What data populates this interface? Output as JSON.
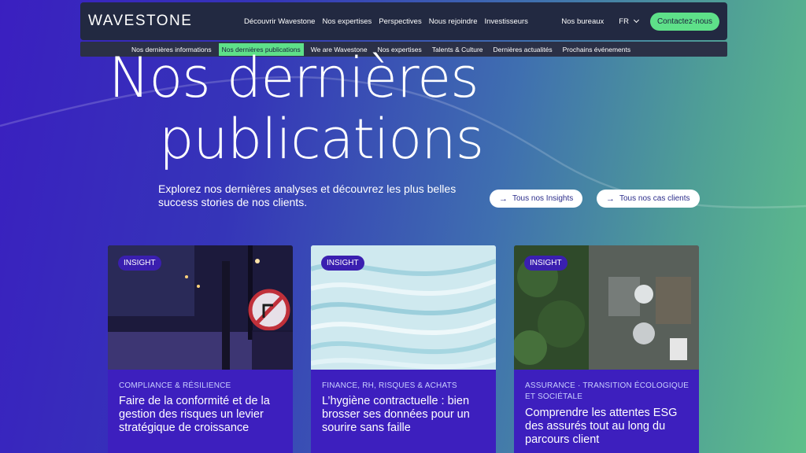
{
  "colors": {
    "accent": "#5ee089",
    "nav_bg": "#222941",
    "card_bg": "#3d1fbe"
  },
  "header": {
    "logo": "WAVESTONE",
    "menu": [
      "Découvrir Wavestone",
      "Nos expertises",
      "Perspectives",
      "Nous rejoindre",
      "Investisseurs"
    ],
    "offices": "Nos bureaux",
    "language": "FR",
    "contact": "Contactez-nous"
  },
  "subnav": {
    "items": [
      "Nos dernières informations",
      "Nos dernières publications",
      "We are Wavestone",
      "Nos expertises",
      "Talents & Culture",
      "Dernières actualités",
      "Prochains événements"
    ],
    "active_index": 1
  },
  "hero": {
    "title_line1": "Nos dernières",
    "title_line2": "publications",
    "description": "Explorez nos dernières analyses et découvrez les plus belles success stories de nos clients.",
    "button_insights": "Tous nos Insights",
    "button_clients": "Tous nos cas clients",
    "arrow_icon": "arrow-right-icon"
  },
  "cards": [
    {
      "badge": "INSIGHT",
      "category": "COMPLIANCE & RÉSILIENCE",
      "title": "Faire de la conformité et de la gestion des risques un levier stratégique de croissance"
    },
    {
      "badge": "INSIGHT",
      "category": "FINANCE, RH, RISQUES & ACHATS",
      "title": "L’hygiène contractuelle : bien brosser ses données pour un sourire sans faille"
    },
    {
      "badge": "INSIGHT",
      "category": "ASSURANCE · TRANSITION ÉCOLOGIQUE ET SOCIÉTALE",
      "title": "Comprendre les attentes ESG des assurés tout au long du parcours client"
    }
  ]
}
